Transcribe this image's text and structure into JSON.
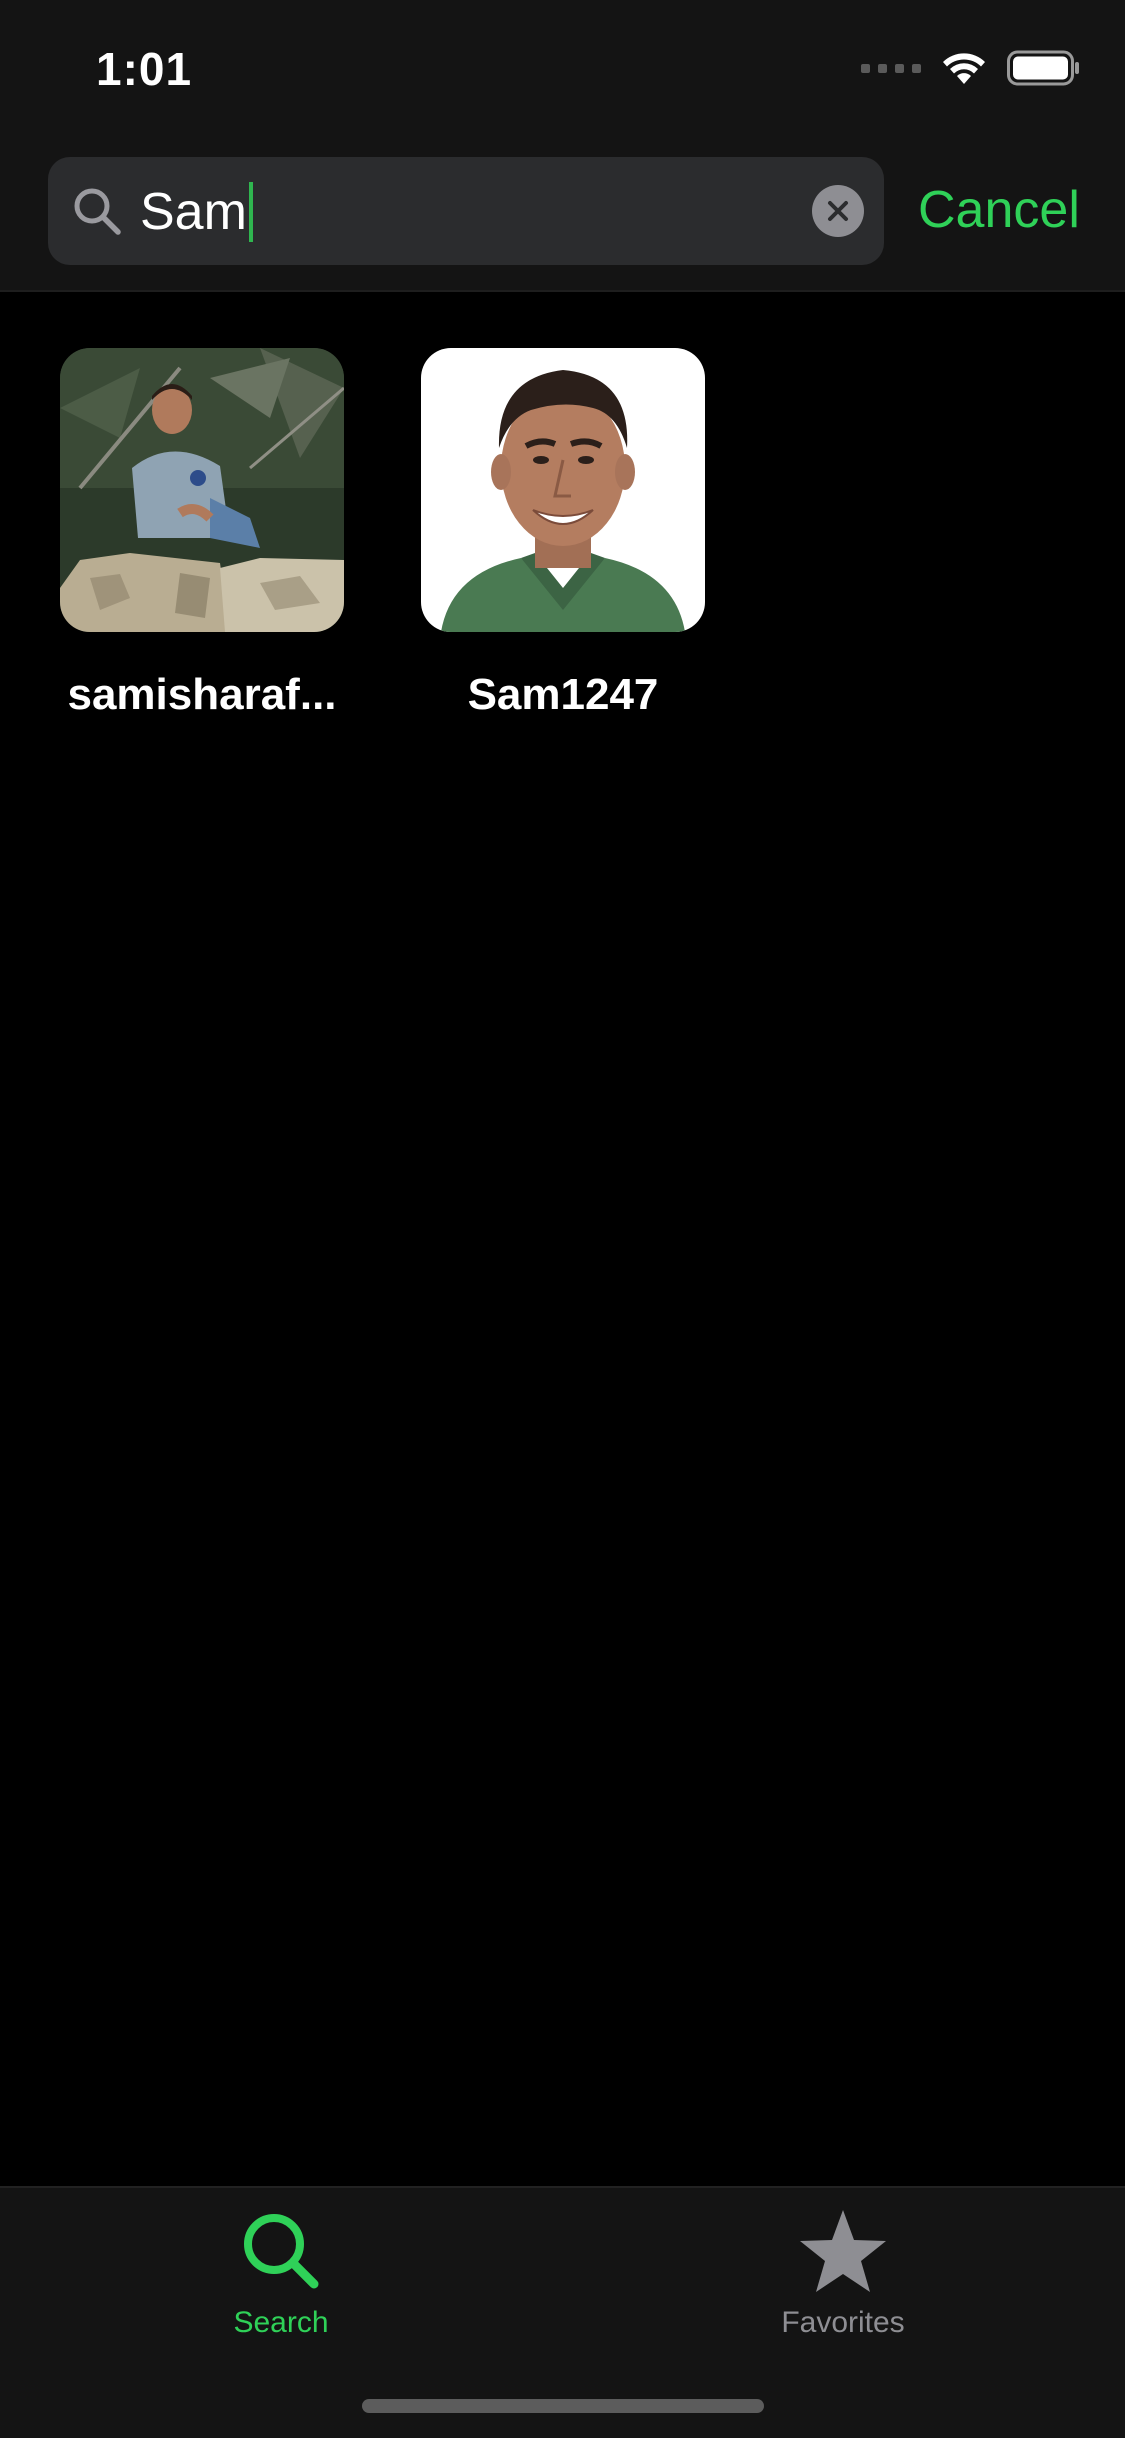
{
  "status_bar": {
    "time": "1:01"
  },
  "search": {
    "query": "Sam",
    "cancel_label": "Cancel"
  },
  "results": [
    {
      "name": "samisharaf..."
    },
    {
      "name": "Sam1247"
    }
  ],
  "tab_bar": {
    "tabs": [
      {
        "label": "Search",
        "icon": "search-icon",
        "active": true
      },
      {
        "label": "Favorites",
        "icon": "star-icon",
        "active": false
      }
    ]
  },
  "colors": {
    "accent": "#2fd158",
    "background": "#000000",
    "bar_background": "#141414",
    "search_field": "#2b2c2e",
    "inactive_tab": "#8e8e93"
  }
}
